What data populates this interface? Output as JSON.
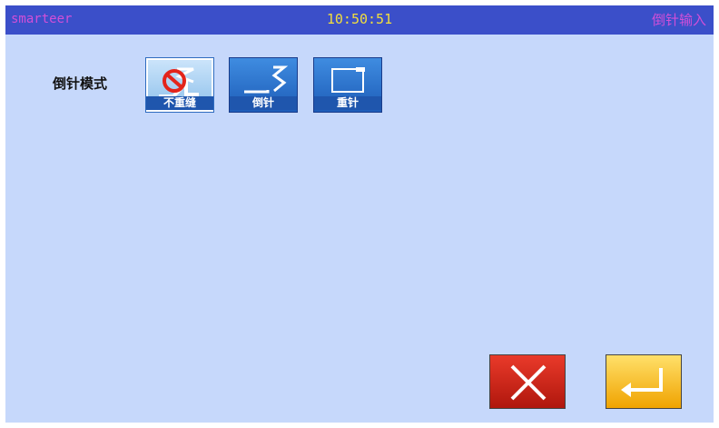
{
  "titlebar": {
    "brand": "smarteer",
    "clock": "10:50:51",
    "mode_title": "倒针输入"
  },
  "backstitch_mode": {
    "label": "倒针模式",
    "options": [
      {
        "id": "none",
        "label": "不重缝",
        "selected": true
      },
      {
        "id": "reverse",
        "label": "倒针",
        "selected": false
      },
      {
        "id": "repeat",
        "label": "重针",
        "selected": false
      }
    ]
  },
  "actions": {
    "cancel_icon": "close-icon",
    "confirm_icon": "enter-return-icon"
  },
  "colors": {
    "screen_bg": "#c6d8fb",
    "titlebar_bg": "#3b4fc9",
    "brand_text": "#d24fd8",
    "clock_text": "#f3df3c",
    "cancel_bg": "#d4241a",
    "confirm_bg": "#f6c12c"
  }
}
